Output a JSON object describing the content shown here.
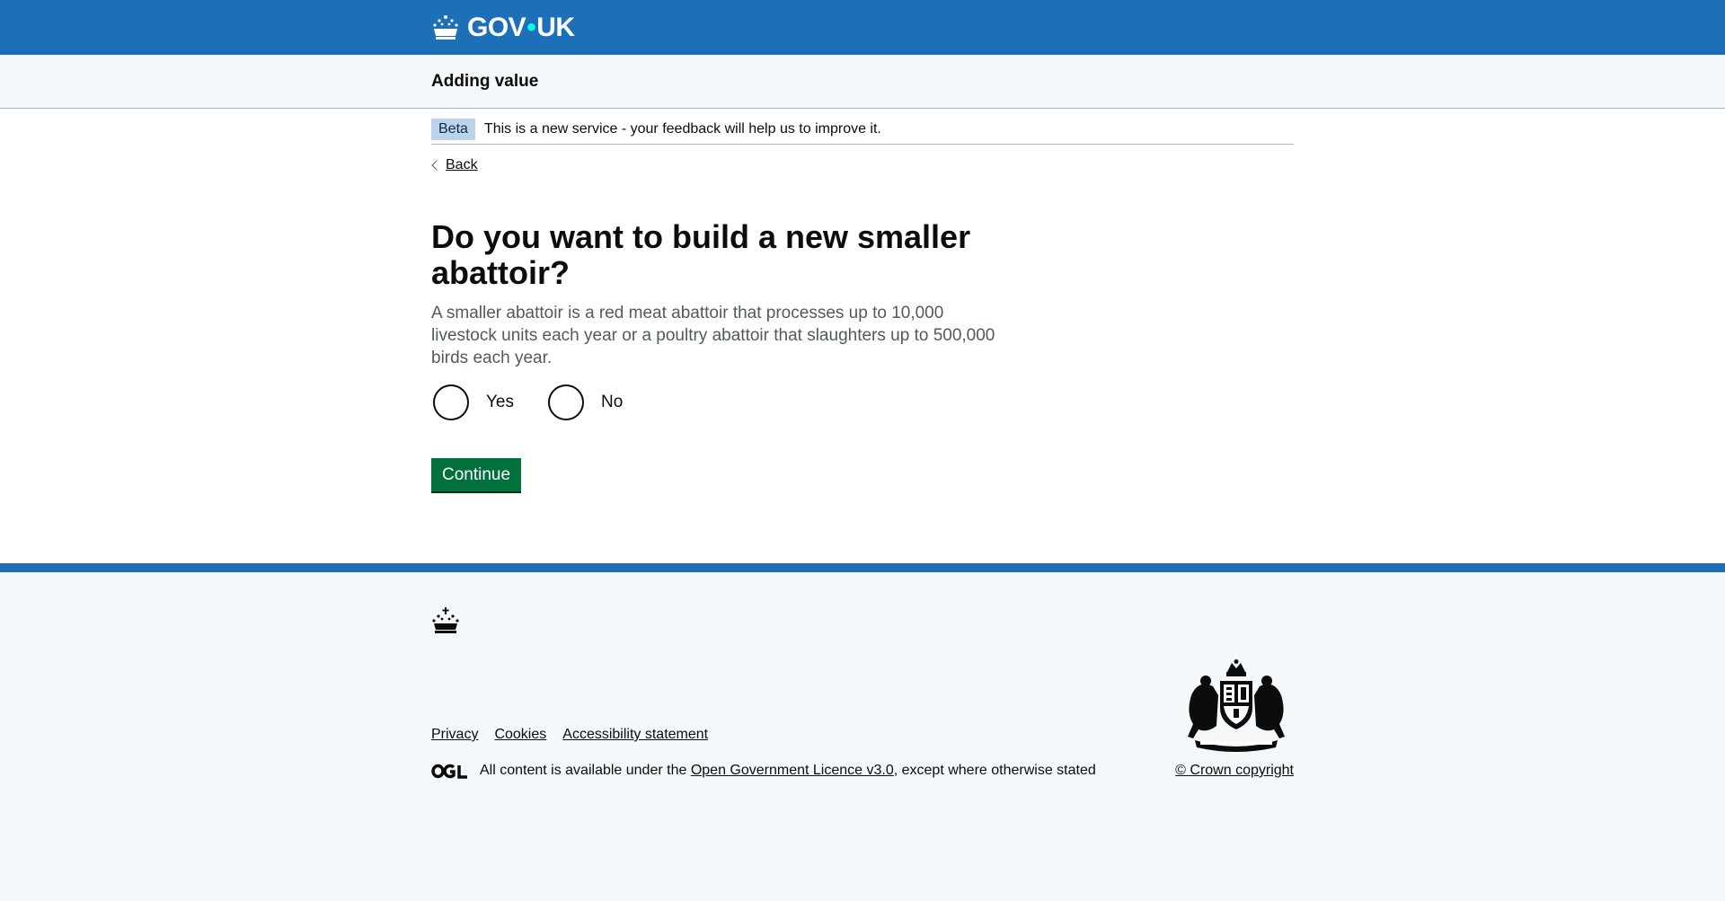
{
  "header": {
    "logo_text_left": "GOV",
    "logo_dot": "•",
    "logo_text_right": "UK",
    "logo_icon": "crown-icon"
  },
  "service": {
    "name": "Adding value"
  },
  "phase_banner": {
    "tag": "Beta",
    "text": "This is a new service - your feedback will help us to improve it."
  },
  "back_link": {
    "label": "Back",
    "icon": "chevron-left-icon"
  },
  "question": {
    "heading": "Do you want to build a new smaller abattoir?",
    "hint": "A smaller abattoir is a red meat abattoir that processes up to 10,000 livestock units each year or a poultry abattoir that slaughters up to 500,000 birds each year.",
    "options": [
      {
        "label": "Yes",
        "selected": false
      },
      {
        "label": "No",
        "selected": false
      }
    ]
  },
  "actions": {
    "continue_label": "Continue"
  },
  "footer": {
    "links": [
      "Privacy",
      "Cookies",
      "Accessibility statement"
    ],
    "licence_prefix": "All content is available under the",
    "licence_link": "Open Government Licence v3.0",
    "licence_suffix": ", except where otherwise stated",
    "copyright": "© Crown copyright",
    "logo_icon": "ogl-logo-icon",
    "crest_icon": "royal-coat-of-arms-icon"
  },
  "colors": {
    "brand_blue": "#1d70b8",
    "button_green": "#00703c",
    "phase_tag_bg": "#bbd4ea"
  }
}
